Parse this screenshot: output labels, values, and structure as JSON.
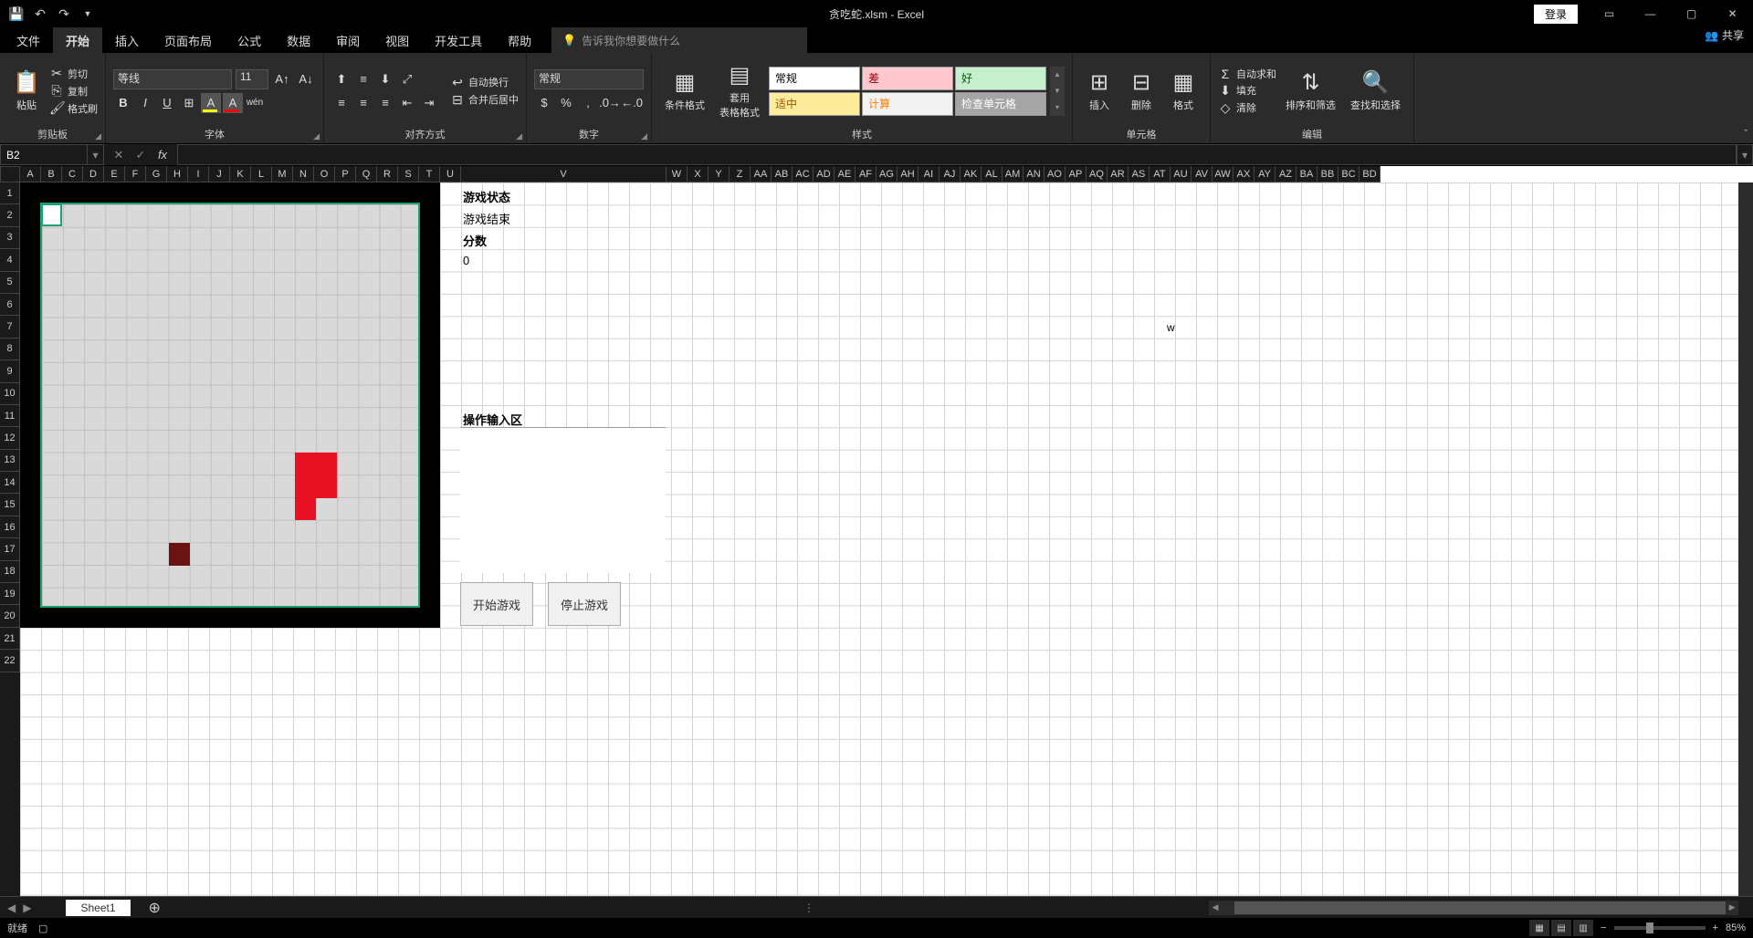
{
  "title": "贪吃蛇.xlsm - Excel",
  "login": "登录",
  "tabs": {
    "file": "文件",
    "home": "开始",
    "insert": "插入",
    "page_layout": "页面布局",
    "formulas": "公式",
    "data": "数据",
    "review": "审阅",
    "view": "视图",
    "dev": "开发工具",
    "help": "帮助"
  },
  "tell_me": "告诉我你想要做什么",
  "share": "共享",
  "clipboard": {
    "paste": "粘贴",
    "cut": "剪切",
    "copy": "复制",
    "format_painter": "格式刷",
    "group": "剪贴板"
  },
  "font": {
    "name": "等线",
    "size": "11",
    "group": "字体"
  },
  "alignment": {
    "wrap": "自动换行",
    "merge": "合并后居中",
    "group": "对齐方式"
  },
  "number": {
    "format": "常规",
    "group": "数字"
  },
  "styles": {
    "cond": "条件格式",
    "table": "套用\n表格格式",
    "normal": "常规",
    "bad": "差",
    "good": "好",
    "neutral": "适中",
    "calc": "计算",
    "check": "检查单元格",
    "group": "样式"
  },
  "cells": {
    "insert": "插入",
    "delete": "删除",
    "format": "格式",
    "group": "单元格"
  },
  "editing": {
    "sum": "自动求和",
    "fill": "填充",
    "clear": "清除",
    "sort": "排序和筛选",
    "find": "查找和选择",
    "group": "编辑"
  },
  "name_box": "B2",
  "columns_narrow": [
    "A",
    "B",
    "C",
    "D",
    "E",
    "F",
    "G",
    "H",
    "I",
    "J",
    "K",
    "L",
    "M",
    "N",
    "O",
    "P",
    "Q",
    "R",
    "S",
    "T",
    "U"
  ],
  "col_v": "V",
  "columns_rest": [
    "W",
    "X",
    "Y",
    "Z",
    "AA",
    "AB",
    "AC",
    "AD",
    "AE",
    "AF",
    "AG",
    "AH",
    "AI",
    "AJ",
    "AK",
    "AL",
    "AM",
    "AN",
    "AO",
    "AP",
    "AQ",
    "AR",
    "AS",
    "AT",
    "AU",
    "AV",
    "AW",
    "AX",
    "AY",
    "AZ",
    "BA",
    "BB",
    "BC",
    "BD"
  ],
  "rows": [
    "1",
    "2",
    "3",
    "4",
    "5",
    "6",
    "7",
    "8",
    "9",
    "10",
    "11",
    "12",
    "13",
    "14",
    "15",
    "16",
    "17",
    "18",
    "19",
    "20",
    "21",
    "22"
  ],
  "game": {
    "status_label": "游戏状态",
    "status_value": "游戏结束",
    "score_label": "分数",
    "score_value": "0",
    "input_label": "操作输入区",
    "start_btn": "开始游戏",
    "stop_btn": "停止游戏",
    "cell_w": "w"
  },
  "sheet_tab": "Sheet1",
  "status": {
    "ready": "就绪",
    "zoom": "85%"
  }
}
